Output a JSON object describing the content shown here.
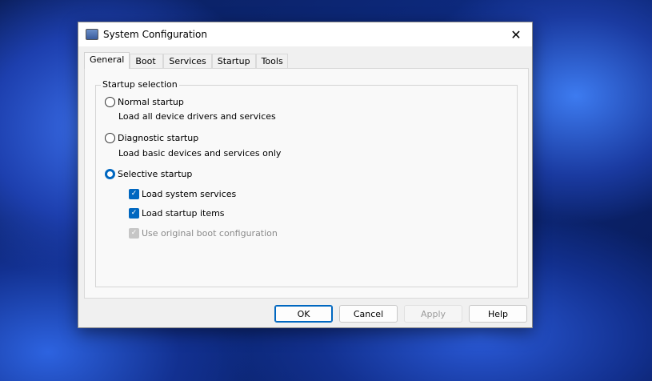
{
  "window": {
    "title": "System Configuration"
  },
  "tabs": [
    {
      "label": "General"
    },
    {
      "label": "Boot"
    },
    {
      "label": "Services"
    },
    {
      "label": "Startup"
    },
    {
      "label": "Tools"
    }
  ],
  "group": {
    "label": "Startup selection",
    "normal": {
      "label": "Normal startup",
      "desc": "Load all device drivers and services"
    },
    "diagnostic": {
      "label": "Diagnostic startup",
      "desc": "Load basic devices and services only"
    },
    "selective": {
      "label": "Selective startup",
      "options": [
        {
          "label": "Load system services"
        },
        {
          "label": "Load startup items"
        },
        {
          "label": "Use original boot configuration"
        }
      ]
    }
  },
  "buttons": {
    "ok": "OK",
    "cancel": "Cancel",
    "apply": "Apply",
    "help": "Help"
  },
  "close_glyph": "✕"
}
